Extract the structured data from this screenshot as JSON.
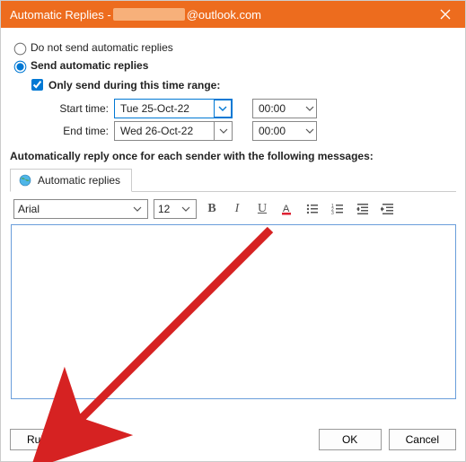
{
  "title": {
    "prefix": "Automatic Replies - ",
    "suffix": "@outlook.com"
  },
  "radios": {
    "no_send": "Do not send automatic replies",
    "send": "Send automatic replies"
  },
  "time_range": {
    "only_send": "Only send during this time range:",
    "start_label": "Start time:",
    "end_label": "End time:",
    "start_date": "Tue 25-Oct-22",
    "end_date": "Wed 26-Oct-22",
    "start_time": "00:00",
    "end_time": "00:00"
  },
  "msg_label": "Automatically reply once for each sender with the following messages:",
  "tab": {
    "label": "Automatic replies"
  },
  "editor": {
    "font": "Arial",
    "size": "12"
  },
  "buttons": {
    "rules": "Rules...",
    "ok": "OK",
    "cancel": "Cancel"
  }
}
